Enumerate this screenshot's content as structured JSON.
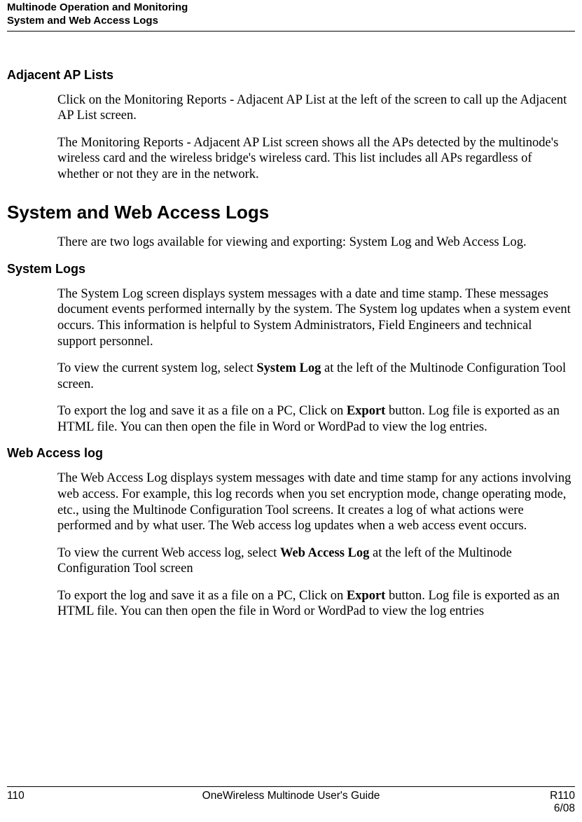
{
  "header": {
    "line1": "Multinode Operation and Monitoring",
    "line2": "System and Web Access Logs"
  },
  "sections": {
    "adjacent": {
      "title": "Adjacent AP Lists",
      "p1": "Click on the Monitoring Reports - Adjacent AP List at the left of the screen to call up the Adjacent AP List screen.",
      "p2": "The Monitoring Reports - Adjacent AP List screen shows all the APs detected by the multinode's wireless card and the wireless bridge's wireless card. This list includes all APs regardless of whether or not they are in the network."
    },
    "syswal": {
      "title": "System and Web Access Logs",
      "p1": "There are two logs available for viewing and exporting:  System Log and Web Access Log."
    },
    "syslogs": {
      "title": "System Logs",
      "p1": "The System Log screen displays system messages with a date and time stamp. These messages document events performed internally by the system.  The System log updates when a system event occurs. This information is helpful to System Administrators, Field Engineers and technical support personnel.",
      "p2a": "To view the current system log, select ",
      "p2b": "System Log",
      "p2c": " at the left of the Multinode Configuration Tool screen.",
      "p3a": "To export the log and save it as a file on a PC, Click on ",
      "p3b": "Export",
      "p3c": " button.  Log file is exported as an HTML file.  You can then open the file in Word or WordPad to view the log entries."
    },
    "weblog": {
      "title": "Web Access log",
      "p1": "The Web Access Log displays system messages with date and time stamp for any actions involving web access. For example, this log records when you set encryption mode, change operating mode, etc., using the Multinode Configuration Tool screens. It creates a log of what actions were performed and by what user.  The Web access log updates when a web access event occurs.",
      "p2a": "To view the current Web access log, select ",
      "p2b": "Web Access Log",
      "p2c": " at the left of the Multinode Configuration Tool screen",
      "p3a": "To export the log and save it as a file on a PC, Click on ",
      "p3b": "Export",
      "p3c": " button.  Log file is exported as an HTML file.  You can then open the file in Word or WordPad to view the log entries"
    }
  },
  "footer": {
    "page": "110",
    "center": "OneWireless Multinode User's Guide",
    "right1": "R110",
    "right2": "6/08"
  }
}
